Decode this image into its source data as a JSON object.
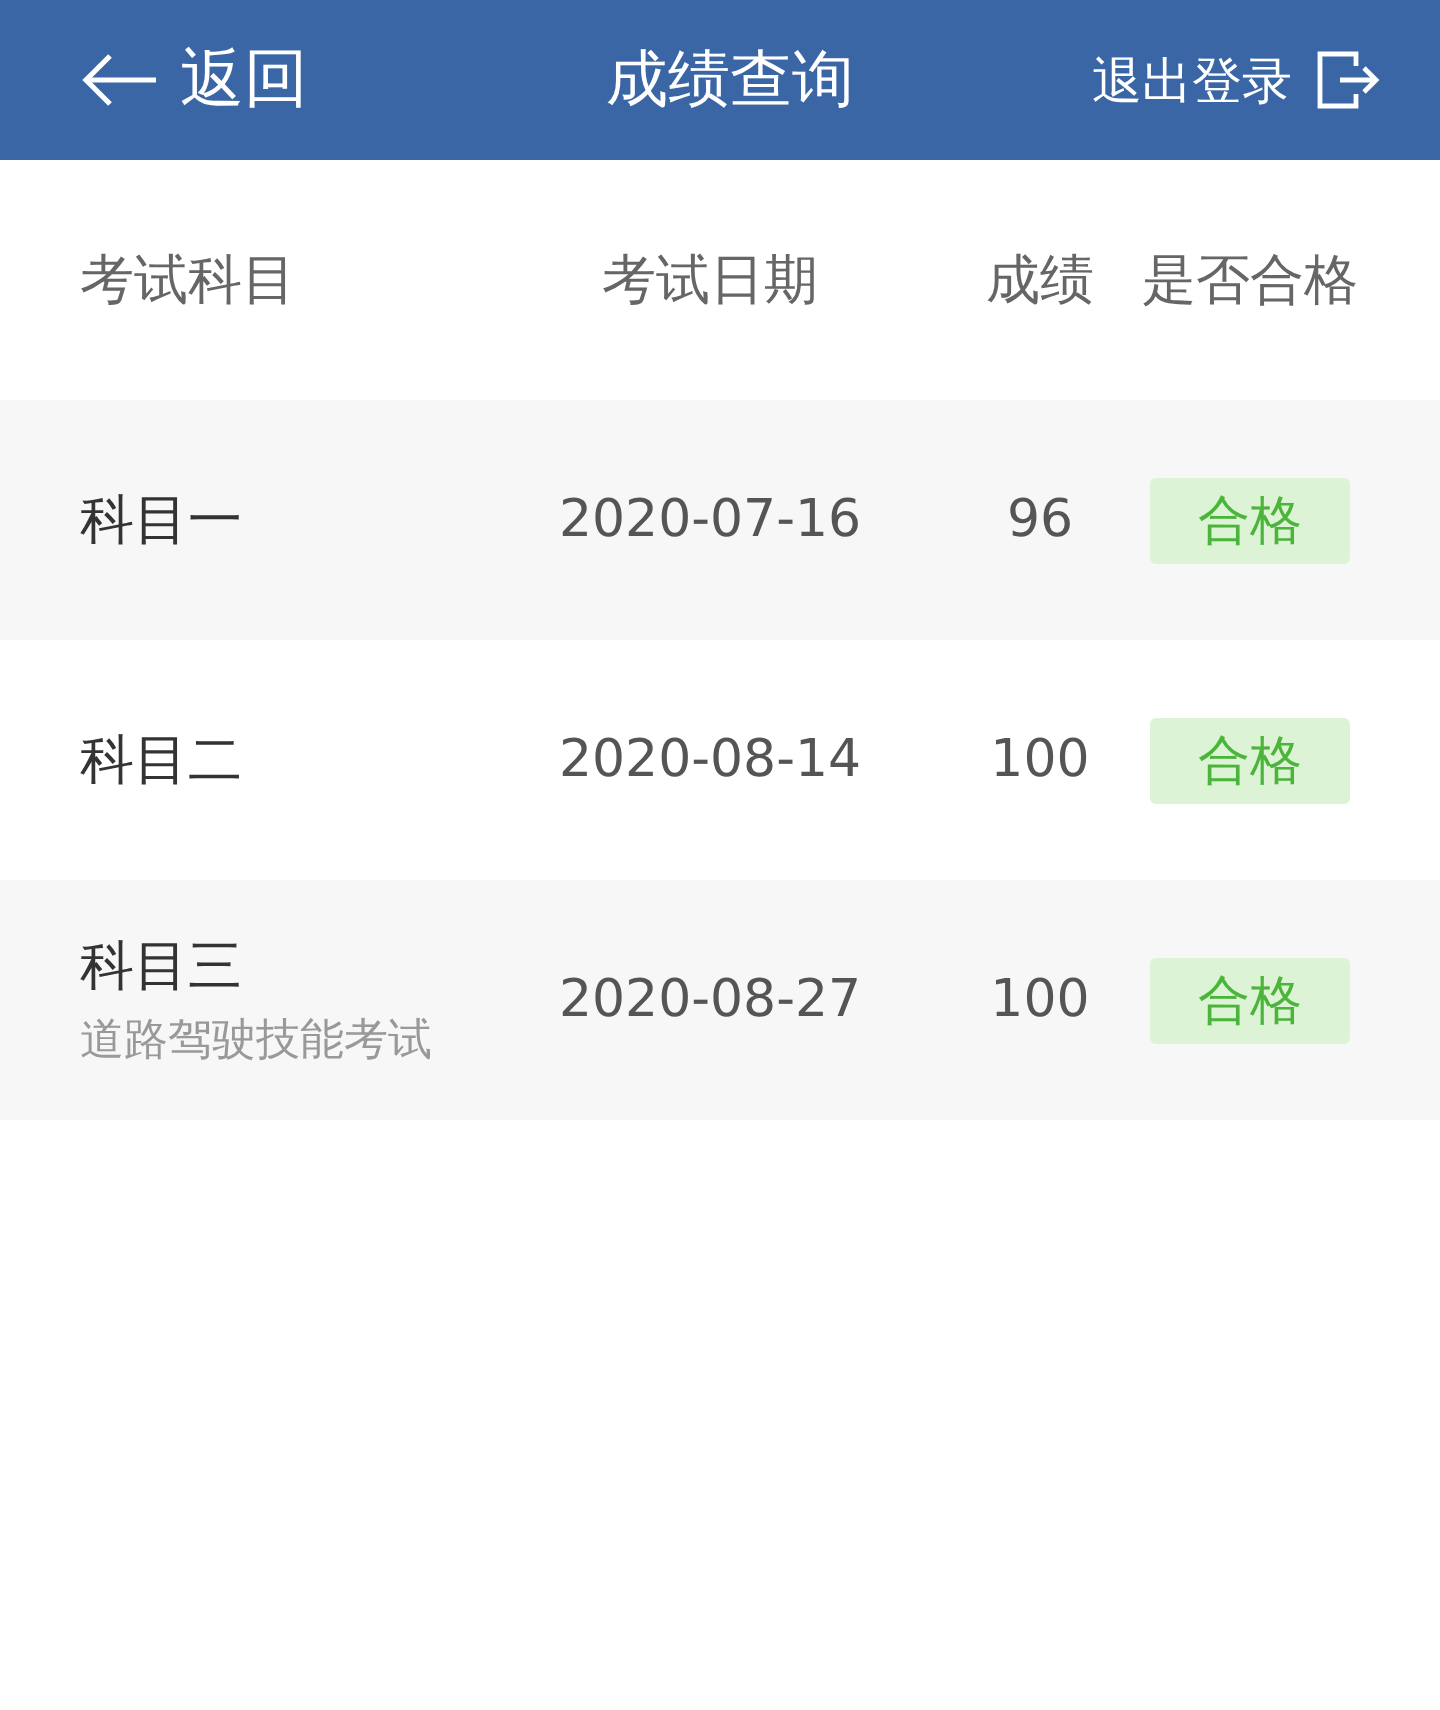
{
  "header": {
    "back": "返回",
    "title": "成绩查询",
    "logout": "退出登录"
  },
  "table": {
    "columns": [
      "考试科目",
      "考试日期",
      "成绩",
      "是否合格"
    ],
    "rows": [
      {
        "subject": "科目一",
        "date": "2020-07-16",
        "score": "96",
        "result": "合格",
        "passed": true
      },
      {
        "subject": "科目二",
        "date": "2020-08-14",
        "score": "100",
        "result": "合格",
        "passed": true
      },
      {
        "subject": "科目三",
        "note": "道路驾驶技能考试",
        "date": "2020-08-27",
        "score": "100",
        "result": "合格",
        "passed": true
      }
    ]
  }
}
